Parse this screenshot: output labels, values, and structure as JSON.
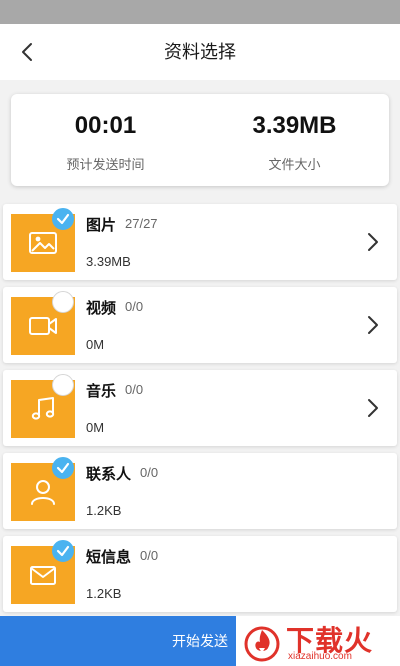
{
  "header": {
    "title": "资料选择"
  },
  "summary": {
    "time_value": "00:01",
    "time_label": "预计发送时间",
    "size_value": "3.39MB",
    "size_label": "文件大小"
  },
  "items": [
    {
      "title": "图片",
      "count": "27/27",
      "size": "3.39MB",
      "checked": true,
      "icon": "image-icon"
    },
    {
      "title": "视频",
      "count": "0/0",
      "size": "0M",
      "checked": false,
      "icon": "video-icon"
    },
    {
      "title": "音乐",
      "count": "0/0",
      "size": "0M",
      "checked": false,
      "icon": "music-icon"
    },
    {
      "title": "联系人",
      "count": "0/0",
      "size": "1.2KB",
      "checked": true,
      "icon": "contact-icon"
    },
    {
      "title": "短信息",
      "count": "0/0",
      "size": "1.2KB",
      "checked": true,
      "icon": "message-icon"
    }
  ],
  "bottom": {
    "send_label": "开始发送"
  },
  "watermark": {
    "brand": "下载火",
    "url": "xiazaihuo.com"
  },
  "colors": {
    "accent": "#2f7ee0",
    "thumb": "#f6a623",
    "check": "#4ab3f0",
    "brand": "#e0322a"
  }
}
